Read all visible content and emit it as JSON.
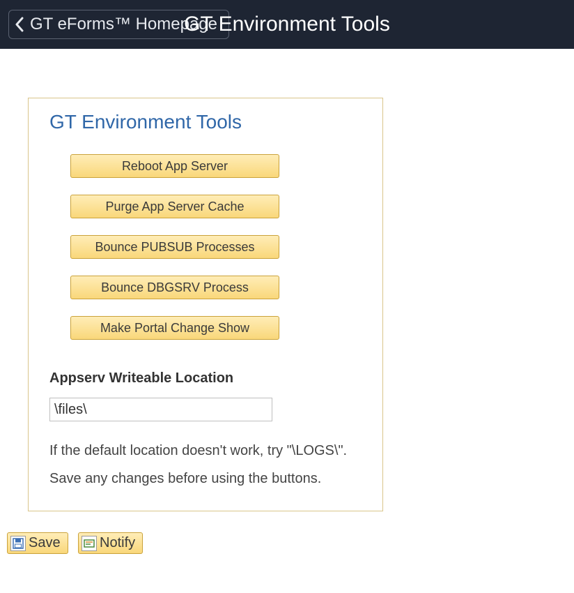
{
  "header": {
    "back_label": "GT eForms™ Homepage",
    "title": "GT Environment Tools"
  },
  "panel": {
    "title": "GT Environment Tools",
    "buttons": [
      "Reboot App Server",
      "Purge App Server Cache",
      "Bounce PUBSUB Processes",
      "Bounce DBGSRV Process",
      "Make Portal Change Show"
    ],
    "location_label": "Appserv Writeable Location",
    "location_value": "\\files\\",
    "help1": "If the default location doesn't work, try \"\\LOGS\\\".",
    "help2": "Save any changes before using the buttons."
  },
  "footer": {
    "save_label": "Save",
    "notify_label": "Notify"
  }
}
